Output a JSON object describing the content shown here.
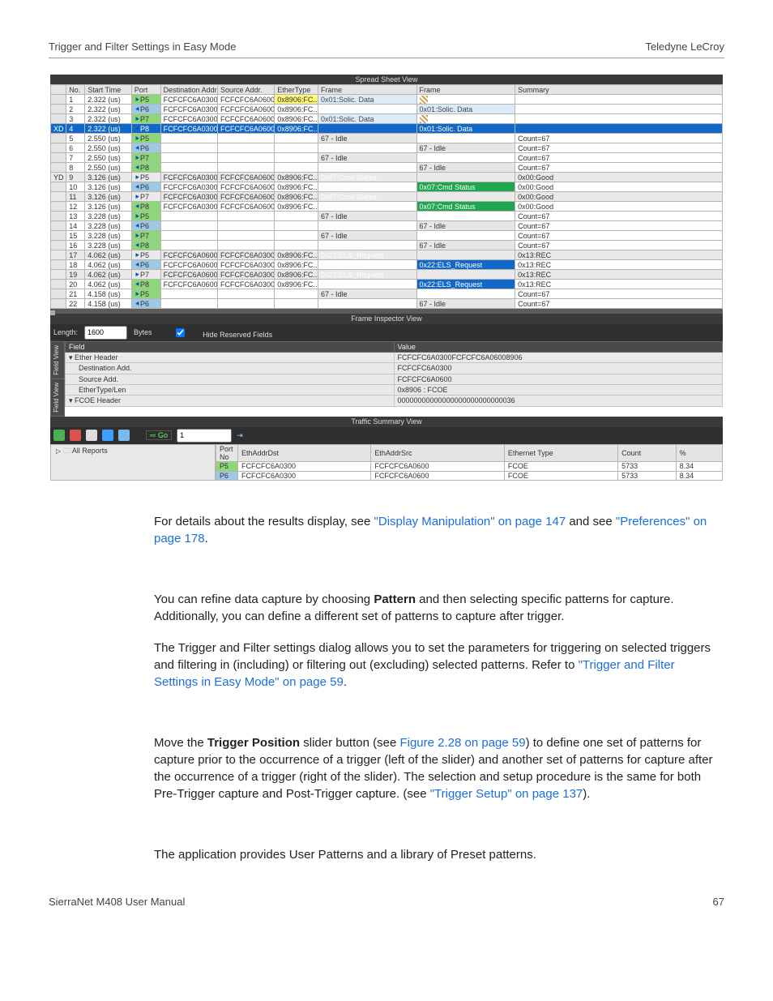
{
  "header": {
    "left": "Trigger and Filter Settings in Easy Mode",
    "right": "Teledyne LeCroy"
  },
  "footer": {
    "left": "SierraNet M408 User Manual",
    "right": "67"
  },
  "spreadsheet": {
    "title": "Spread Sheet View",
    "cols": [
      "No.",
      "Start Time",
      "Port",
      "Destination Addr.",
      "Source Addr.",
      "EtherType",
      "Frame",
      "Frame",
      "Summary"
    ],
    "rows": [
      {
        "m": "",
        "no": "1",
        "t": "2.322 (us)",
        "p": "P5",
        "pa": "l",
        "d": "FCFCFC6A0300",
        "s": "FCFCFC6A0600",
        "e": "0x8906:FC...",
        "f1": "0x01:Solic. Data",
        "f1c": "frame-solic",
        "f2": "",
        "f2c": "",
        "sum": "",
        "hatch": true,
        "eCls": "hl-yellow"
      },
      {
        "m": "",
        "no": "2",
        "t": "2.322 (us)",
        "p": "P6",
        "pa": "r",
        "d": "FCFCFC6A0300",
        "s": "FCFCFC6A0600",
        "e": "0x8906:FC...",
        "f1": "",
        "f1c": "",
        "f2": "0x01:Solic. Data",
        "f2c": "frame-solic",
        "sum": "",
        "hatch": true
      },
      {
        "m": "",
        "no": "3",
        "t": "2.322 (us)",
        "p": "P7",
        "pa": "l",
        "d": "FCFCFC6A0300",
        "s": "FCFCFC6A0600",
        "e": "0x8906:FC...",
        "f1": "0x01:Solic. Data",
        "f1c": "frame-solic",
        "f2": "",
        "f2c": "",
        "sum": "",
        "hatch": true
      },
      {
        "m": "XD",
        "mCls": "hl-sel",
        "no": "4",
        "t": "2.322 (us)",
        "p": "P8",
        "pa": "r",
        "d": "FCFCFC6A0300",
        "s": "FCFCFC6A0600",
        "e": "0x8906:FC...",
        "f1": "",
        "f1c": "",
        "f2": "0x01:Solic. Data",
        "f2c": "frame-solic",
        "sum": "",
        "hatch": true,
        "rowCls": "hl-sel"
      },
      {
        "m": "",
        "no": "5",
        "t": "2.550 (us)",
        "p": "P5",
        "pa": "l",
        "d": "",
        "s": "",
        "e": "",
        "f1": "67 - Idle",
        "f1c": "frame-idle",
        "f2": "",
        "f2c": "",
        "sum": "Count=67"
      },
      {
        "m": "",
        "no": "6",
        "t": "2.550 (us)",
        "p": "P6",
        "pa": "r",
        "d": "",
        "s": "",
        "e": "",
        "f1": "",
        "f1c": "",
        "f2": "67 - Idle",
        "f2c": "frame-idle",
        "sum": "Count=67"
      },
      {
        "m": "",
        "no": "7",
        "t": "2.550 (us)",
        "p": "P7",
        "pa": "l",
        "d": "",
        "s": "",
        "e": "",
        "f1": "67 - Idle",
        "f1c": "frame-idle",
        "f2": "",
        "f2c": "",
        "sum": "Count=67"
      },
      {
        "m": "",
        "no": "8",
        "t": "2.550 (us)",
        "p": "P8",
        "pa": "r",
        "d": "",
        "s": "",
        "e": "",
        "f1": "",
        "f1c": "",
        "f2": "67 - Idle",
        "f2c": "frame-idle",
        "sum": "Count=67"
      },
      {
        "m": "YD",
        "no": "9",
        "t": "3.126 (us)",
        "p": "P5",
        "pa": "l",
        "d": "FCFCFC6A0300",
        "s": "FCFCFC6A0600",
        "e": "0x8906:FC...",
        "f1": "0x07:Cmd Status",
        "f1c": "frame-cmd",
        "f2": "",
        "f2c": "",
        "sum": "0x00:Good",
        "rowCls": "hl-row-grey"
      },
      {
        "m": "",
        "no": "10",
        "t": "3.126 (us)",
        "p": "P6",
        "pa": "r",
        "d": "FCFCFC6A0300",
        "s": "FCFCFC6A0600",
        "e": "0x8906:FC...",
        "f1": "",
        "f1c": "",
        "f2": "0x07:Cmd Status",
        "f2c": "frame-cmd",
        "sum": "0x00:Good"
      },
      {
        "m": "",
        "no": "11",
        "t": "3.126 (us)",
        "p": "P7",
        "pa": "l",
        "d": "FCFCFC6A0300",
        "s": "FCFCFC6A0600",
        "e": "0x8906:FC...",
        "f1": "0x07:Cmd Status",
        "f1c": "frame-cmd",
        "f2": "",
        "f2c": "",
        "sum": "0x00:Good",
        "rowCls": "hl-row-grey"
      },
      {
        "m": "",
        "no": "12",
        "t": "3.126 (us)",
        "p": "P8",
        "pa": "r",
        "d": "FCFCFC6A0300",
        "s": "FCFCFC6A0600",
        "e": "0x8906:FC...",
        "f1": "",
        "f1c": "",
        "f2": "0x07:Cmd Status",
        "f2c": "frame-cmd",
        "sum": "0x00:Good"
      },
      {
        "m": "",
        "no": "13",
        "t": "3.228 (us)",
        "p": "P5",
        "pa": "l",
        "d": "",
        "s": "",
        "e": "",
        "f1": "67 - Idle",
        "f1c": "frame-idle",
        "f2": "",
        "f2c": "",
        "sum": "Count=67"
      },
      {
        "m": "",
        "no": "14",
        "t": "3.228 (us)",
        "p": "P6",
        "pa": "r",
        "d": "",
        "s": "",
        "e": "",
        "f1": "",
        "f1c": "",
        "f2": "67 - Idle",
        "f2c": "frame-idle",
        "sum": "Count=67"
      },
      {
        "m": "",
        "no": "15",
        "t": "3.228 (us)",
        "p": "P7",
        "pa": "l",
        "d": "",
        "s": "",
        "e": "",
        "f1": "67 - Idle",
        "f1c": "frame-idle",
        "f2": "",
        "f2c": "",
        "sum": "Count=67"
      },
      {
        "m": "",
        "no": "16",
        "t": "3.228 (us)",
        "p": "P8",
        "pa": "r",
        "d": "",
        "s": "",
        "e": "",
        "f1": "",
        "f1c": "",
        "f2": "67 - Idle",
        "f2c": "frame-idle",
        "sum": "Count=67"
      },
      {
        "m": "",
        "no": "17",
        "t": "4.062 (us)",
        "p": "P5",
        "pa": "l",
        "d": "FCFCFC6A0600",
        "s": "FCFCFC6A0300",
        "e": "0x8906:FC...",
        "f1": "0x22:ELS_Request",
        "f1c": "frame-els",
        "f2": "",
        "f2c": "",
        "sum": "0x13:REC",
        "rowCls": "hl-row-grey"
      },
      {
        "m": "",
        "no": "18",
        "t": "4.062 (us)",
        "p": "P6",
        "pa": "r",
        "d": "FCFCFC6A0600",
        "s": "FCFCFC6A0300",
        "e": "0x8906:FC...",
        "f1": "",
        "f1c": "",
        "f2": "0x22:ELS_Request",
        "f2c": "frame-els",
        "sum": "0x13:REC"
      },
      {
        "m": "",
        "no": "19",
        "t": "4.062 (us)",
        "p": "P7",
        "pa": "l",
        "d": "FCFCFC6A0600",
        "s": "FCFCFC6A0300",
        "e": "0x8906:FC...",
        "f1": "0x22:ELS_Request",
        "f1c": "frame-els",
        "f2": "",
        "f2c": "",
        "sum": "0x13:REC",
        "rowCls": "hl-row-grey"
      },
      {
        "m": "",
        "no": "20",
        "t": "4.062 (us)",
        "p": "P8",
        "pa": "r",
        "d": "FCFCFC6A0600",
        "s": "FCFCFC6A0300",
        "e": "0x8906:FC...",
        "f1": "",
        "f1c": "",
        "f2": "0x22:ELS_Request",
        "f2c": "frame-els",
        "sum": "0x13:REC"
      },
      {
        "m": "",
        "no": "21",
        "t": "4.158 (us)",
        "p": "P5",
        "pa": "l",
        "d": "",
        "s": "",
        "e": "",
        "f1": "67 - Idle",
        "f1c": "frame-idle",
        "f2": "",
        "f2c": "",
        "sum": "Count=67"
      },
      {
        "m": "",
        "no": "22",
        "t": "4.158 (us)",
        "p": "P6",
        "pa": "r",
        "d": "",
        "s": "",
        "e": "",
        "f1": "",
        "f1c": "",
        "f2": "67 - Idle",
        "f2c": "frame-idle",
        "sum": "Count=67"
      }
    ]
  },
  "frameInspector": {
    "title": "Frame Inspector View",
    "lengthLabel": "Length:",
    "lengthValue": "1600",
    "lengthUnit": "Bytes",
    "hideReserved": "Hide Reserved Fields",
    "tabs": [
      "Field View",
      "Field View"
    ],
    "cols": [
      "Field",
      "Value"
    ],
    "rows": [
      {
        "f": "▾ Ether Header",
        "v": "FCFCFC6A0300FCFCFC6A06008906",
        "lvl": 0,
        "tri": true
      },
      {
        "f": "Destination Add.",
        "v": "FCFCFC6A0300",
        "lvl": 1
      },
      {
        "f": "Source Add.",
        "v": "FCFCFC6A0600",
        "lvl": 1
      },
      {
        "f": "EtherType/Len",
        "v": "0x8906 : FCOE",
        "lvl": 1
      },
      {
        "f": "▾ FCOE Header",
        "v": "00000000000000000000000000036",
        "lvl": 0,
        "tri": true
      }
    ]
  },
  "trafficSummary": {
    "title": "Traffic Summary View",
    "goLabel": "Go",
    "goValue": "1",
    "treeRoot": "All Reports",
    "cols": [
      "Port No",
      "EthAddrDst",
      "EthAddrSrc",
      "Ethernet Type",
      "Count",
      "%"
    ],
    "rows": [
      {
        "port": "P5",
        "pc": "tsv-port-p5",
        "dst": "FCFCFC6A0300",
        "src": "FCFCFC6A0600",
        "etype": "FCOE",
        "count": "5733",
        "pct": "8.34"
      },
      {
        "port": "P6",
        "pc": "tsv-port-p6",
        "dst": "FCFCFC6A0300",
        "src": "FCFCFC6A0600",
        "etype": "FCOE",
        "count": "5733",
        "pct": "8.34"
      }
    ]
  },
  "para1a": "For details about the results display, see ",
  "para1link1": "\"Display Manipulation\" on page 147",
  "para1b": " and see ",
  "para1link2": "\"Preferences\" on page 178",
  "para1c": ".",
  "para2a": "You can refine data capture by choosing ",
  "para2bold": "Pattern",
  "para2b": " and then then selecting specific patterns for capture. Additionally, you can define a different set of patterns to capture after trigger.",
  "para3a": "The Trigger and Filter settings dialog allows you to set the parameters for triggering on selected triggers and filtering in (including) or filtering out (excluding) selected patterns. Refer to ",
  "para3link": "\"Trigger and Filter Settings in Easy Mode\" on page 59",
  "para3b": ".",
  "para4a": "Move the ",
  "para4bold": "Trigger Position",
  "para4b": " slider button (see ",
  "para4link1": "Figure 2.28 on page 59",
  "para4c": ") to define one set of patterns for capture prior to the occurrence of a trigger (left of the slider) and another set of patterns for capture after the occurrence of a trigger (right of the slider). The selection and setup procedure is the same for both Pre-Trigger capture and Post-Trigger capture. (see ",
  "para4link2": "\"Trigger Setup\" on page 137",
  "para4d": ").",
  "para5": "The application provides User Patterns and a library of Preset patterns."
}
